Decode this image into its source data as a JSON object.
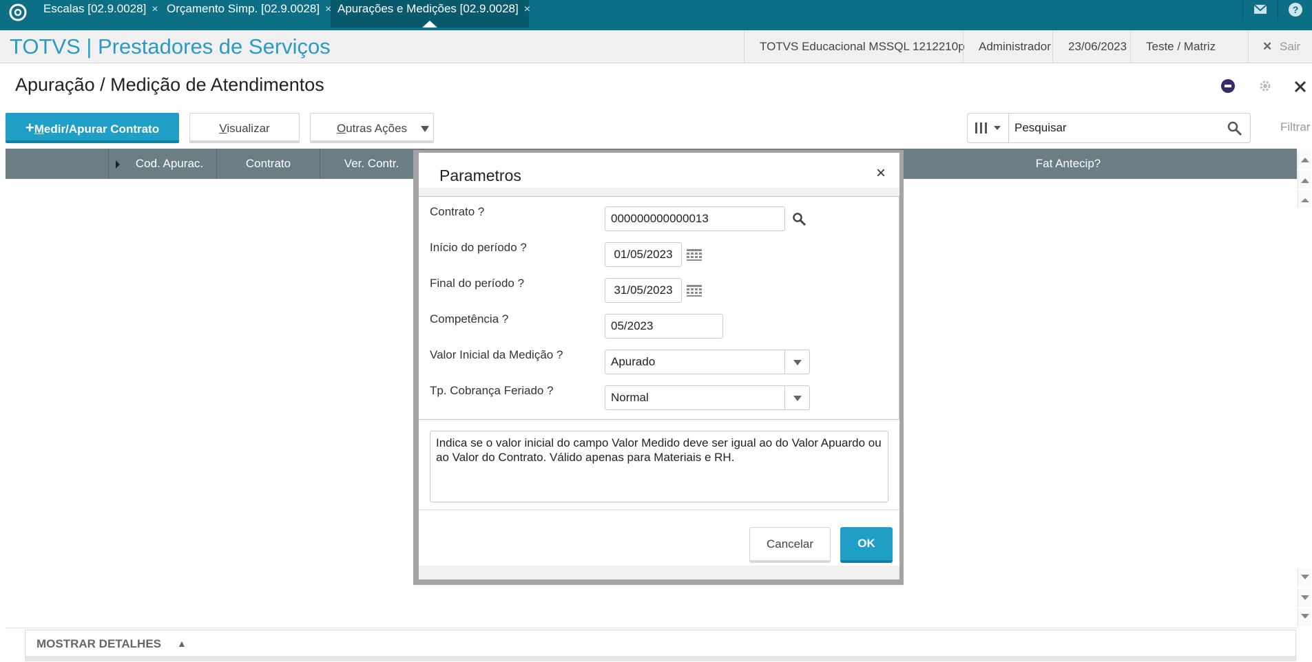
{
  "tabs": [
    {
      "label": "Escalas [02.9.0028]",
      "close": "×"
    },
    {
      "label": "Orçamento Simp. [02.9.0028]",
      "close": "×"
    },
    {
      "label": "Apurações e Medições [02.9.0028]",
      "close": "×",
      "active": true
    }
  ],
  "header": {
    "app_title": "TOTVS | Prestadores de Serviços",
    "environment": "TOTVS Educacional MSSQL 1212210p",
    "user": "Administrador",
    "date": "23/06/2023",
    "branch": "Teste / Matriz",
    "logout_label": "Sair"
  },
  "page": {
    "title": "Apuração / Medição de Atendimentos"
  },
  "toolbar": {
    "primary_plus": "+",
    "primary_label_first": "M",
    "primary_label_rest": "edir/Apurar Contrato",
    "view_first": "V",
    "view_rest": "isualizar",
    "other_first": "O",
    "other_rest": "utras Ações",
    "search_value": "Pesquisar",
    "filter_label": "Filtrar"
  },
  "grid": {
    "columns": [
      "Cod. Apurac.",
      "Contrato",
      "Ver. Contr.",
      "Fat Antecip?"
    ]
  },
  "details": {
    "label": "MOSTRAR DETALHES",
    "arrow": "▲"
  },
  "dialog": {
    "title": "Parametros",
    "close": "×",
    "fields": {
      "contrato_label": "Contrato ?",
      "contrato_value": "000000000000013",
      "inicio_label": "Início do período ?",
      "inicio_value": "01/05/2023",
      "final_label": "Final do período ?",
      "final_value": "31/05/2023",
      "competencia_label": "Competência ?",
      "competencia_value": "05/2023",
      "valor_label": "Valor Inicial da Medição ?",
      "valor_value": "Apurado",
      "cobranca_label": "Tp. Cobrança Feriado ?",
      "cobranca_value": "Normal"
    },
    "help_text": "Indica se o valor inicial do campo Valor Medido deve ser igual ao do Valor Apuardo ou ao Valor do Contrato. Válido apenas para Materiais e RH.",
    "cancel_label": "Cancelar",
    "ok_label": "OK"
  },
  "colors": {
    "topbar": "#0d6f86",
    "accent": "#1f9ec6",
    "grid_header": "#6b7e85"
  }
}
